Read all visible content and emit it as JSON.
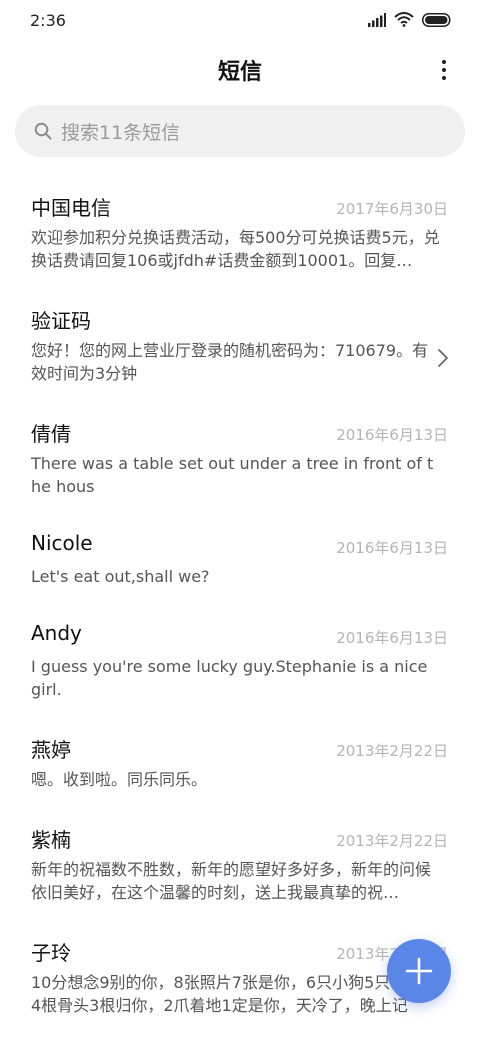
{
  "status_bar": {
    "time": "2:36"
  },
  "header": {
    "title": "短信",
    "more_icon": "more-vertical-icon"
  },
  "search": {
    "placeholder": "搜索11条短信",
    "icon": "search-icon"
  },
  "messages": [
    {
      "sender": "中国电信",
      "date": "2017年6月30日",
      "preview": "欢迎参加积分兑换话费活动，每500分可兑换话费5元，兑换话费请回复106或jfdh#话费金额到10001。回复…"
    },
    {
      "sender": "验证码",
      "date": "",
      "preview": "您好！您的网上营业厅登录的随机密码为：710679。有效时间为3分钟",
      "has_chevron": true
    },
    {
      "sender": "倩倩",
      "date": "2016年6月13日",
      "preview": "There was a table set out under a tree in front of the hous"
    },
    {
      "sender": "Nicole",
      "date": "2016年6月13日",
      "preview": "Let's eat out,shall we?"
    },
    {
      "sender": "Andy",
      "date": "2016年6月13日",
      "preview": "I guess you're some lucky guy.Stephanie is a nice girl."
    },
    {
      "sender": "燕婷",
      "date": "2013年2月22日",
      "preview": "嗯。收到啦。同乐同乐。"
    },
    {
      "sender": "紫楠",
      "date": "2013年2月22日",
      "preview": "新年的祝福数不胜数，新年的愿望好多好多，新年的问候依旧美好，在这个温馨的时刻，送上我最真挚的祝…"
    },
    {
      "sender": "子玲",
      "date": "2013年2月22日",
      "preview": "10分想念9别的你，8张照片7张是你，6只小狗5只像你，4根骨头3根归你，2爪着地1定是你，天冷了，晚上记"
    }
  ],
  "fab": {
    "icon": "plus-icon"
  },
  "colors": {
    "accent": "#5a86e8",
    "search_bg": "#f0f0f0",
    "date": "#b5b5b5"
  }
}
